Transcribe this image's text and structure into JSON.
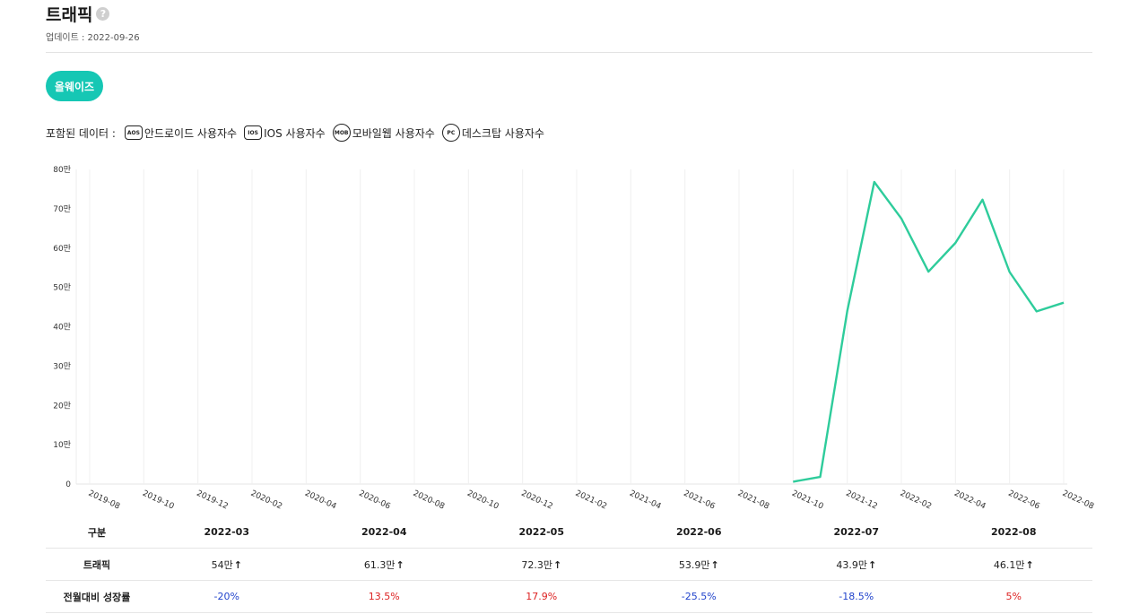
{
  "header": {
    "title": "트래픽",
    "help_icon": "?",
    "updated": "업데이트 : 2022-09-26"
  },
  "app_button": "올웨이즈",
  "included": {
    "label": "포함된 데이터 :",
    "sources": [
      {
        "badge": "AOS",
        "label": "안드로이드 사용자수",
        "icon": "android-icon",
        "shape": "square"
      },
      {
        "badge": "IOS",
        "label": "IOS 사용자수",
        "icon": "ios-icon",
        "shape": "square"
      },
      {
        "badge": "MOB",
        "label": "모바일웹 사용자수",
        "icon": "mobile-web-icon",
        "shape": "circle"
      },
      {
        "badge": "PC",
        "label": "데스크탑 사용자수",
        "icon": "desktop-icon",
        "shape": "circle"
      }
    ]
  },
  "chart_data": {
    "type": "line",
    "title": "",
    "xlabel": "",
    "ylabel": "",
    "x": [
      "2019-08",
      "2019-09",
      "2019-10",
      "2019-11",
      "2019-12",
      "2020-01",
      "2020-02",
      "2020-03",
      "2020-04",
      "2020-05",
      "2020-06",
      "2020-07",
      "2020-08",
      "2020-09",
      "2020-10",
      "2020-11",
      "2020-12",
      "2021-01",
      "2021-02",
      "2021-03",
      "2021-04",
      "2021-05",
      "2021-06",
      "2021-07",
      "2021-08",
      "2021-09",
      "2021-10",
      "2021-11",
      "2021-12",
      "2022-01",
      "2022-02",
      "2022-03",
      "2022-04",
      "2022-05",
      "2022-06",
      "2022-07",
      "2022-08"
    ],
    "x_tick_labels": [
      "2019-08",
      "2019-10",
      "2019-12",
      "2020-02",
      "2020-04",
      "2020-06",
      "2020-08",
      "2020-10",
      "2020-12",
      "2021-02",
      "2021-04",
      "2021-06",
      "2021-08",
      "2021-10",
      "2021-12",
      "2022-02",
      "2022-04",
      "2022-06",
      "2022-08"
    ],
    "series": [
      {
        "values": [
          null,
          null,
          null,
          null,
          null,
          null,
          null,
          null,
          null,
          null,
          null,
          null,
          null,
          null,
          null,
          null,
          null,
          null,
          null,
          null,
          null,
          null,
          null,
          null,
          null,
          null,
          0.6,
          1.8,
          44.0,
          76.8,
          67.5,
          54.0,
          61.3,
          72.3,
          53.9,
          43.9,
          46.1
        ],
        "color": "#2ecc9b"
      }
    ],
    "y_ticks": [
      "0",
      "10만",
      "20만",
      "30만",
      "40만",
      "50만",
      "60만",
      "70만",
      "80만"
    ],
    "ylim": [
      0,
      80
    ],
    "y_unit": "만",
    "grid": "vertical"
  },
  "table": {
    "header": [
      "구분",
      "2022-03",
      "2022-04",
      "2022-05",
      "2022-06",
      "2022-07",
      "2022-08"
    ],
    "rows": [
      {
        "label": "트래픽",
        "cells": [
          "54만",
          "61.3만",
          "72.3만",
          "53.9만",
          "43.9만",
          "46.1만"
        ],
        "arrow": "↑"
      },
      {
        "label": "전월대비 성장률",
        "cells": [
          "-20%",
          "13.5%",
          "17.9%",
          "-25.5%",
          "-18.5%",
          "5%"
        ],
        "signs": [
          "neg",
          "pos",
          "pos",
          "neg",
          "neg",
          "pos"
        ]
      }
    ]
  }
}
